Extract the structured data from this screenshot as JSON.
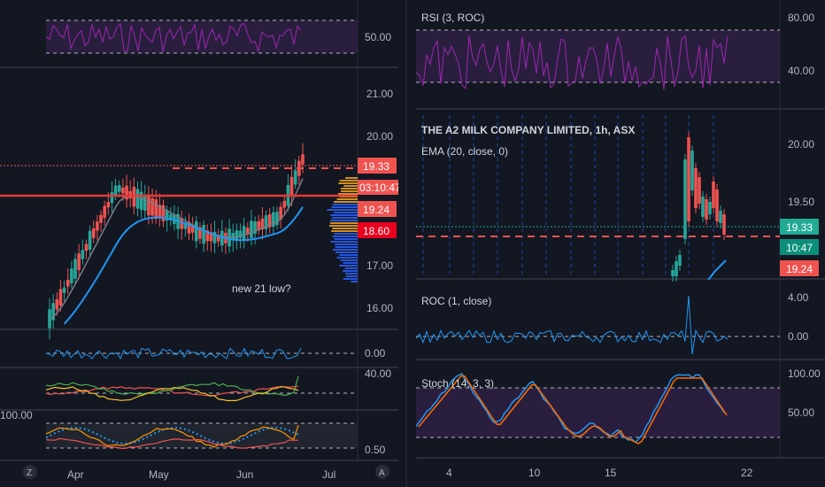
{
  "colors": {
    "bg": "#131722",
    "grid": "#2a2e39",
    "divider": "#434651",
    "up": "#26a69a",
    "down": "#ef5350",
    "rsi": "#9c27b0",
    "band": "#2a1e3f",
    "ema": "#2196f3",
    "sma": "#787b86",
    "price_badge": "#ef5350",
    "teal_badge": "#22ab94"
  },
  "left": {
    "rsi_axis": [
      "50.00"
    ],
    "price_axis": [
      "21.00",
      "20.00",
      "19.33",
      "19.24",
      "18.60",
      "17.00",
      "16.00"
    ],
    "badges": {
      "last": "19.33",
      "countdown": "03:10:47",
      "level1": "19.24",
      "level2": "18.60"
    },
    "annotation": "new 21 low?",
    "roc_axis": "0.00",
    "osc_axis": "40.00",
    "osc2_axis": [
      "100.00",
      "0.50"
    ],
    "x_labels": [
      "Apr",
      "May",
      "Jun",
      "Jul"
    ],
    "corner_left": "Z"
  },
  "right": {
    "rsi_title": "RSI (3, ROC)",
    "rsi_axis": [
      "80.00",
      "40.00"
    ],
    "symbol_title": "THE A2 MILK COMPANY LIMITED, 1h, ASX",
    "ema_title": "EMA (20, close, 0)",
    "price_axis": [
      "20.00",
      "19.50",
      "19.33",
      "10:47",
      "19.24"
    ],
    "roc_title": "ROC (1, close)",
    "roc_axis": [
      "4.00",
      "0.00"
    ],
    "stoch_title": "Stoch (14, 3, 3)",
    "stoch_axis": [
      "100.00",
      "50.00"
    ],
    "x_labels": [
      "4",
      "10",
      "15",
      "22"
    ],
    "corner_left": "A"
  }
}
